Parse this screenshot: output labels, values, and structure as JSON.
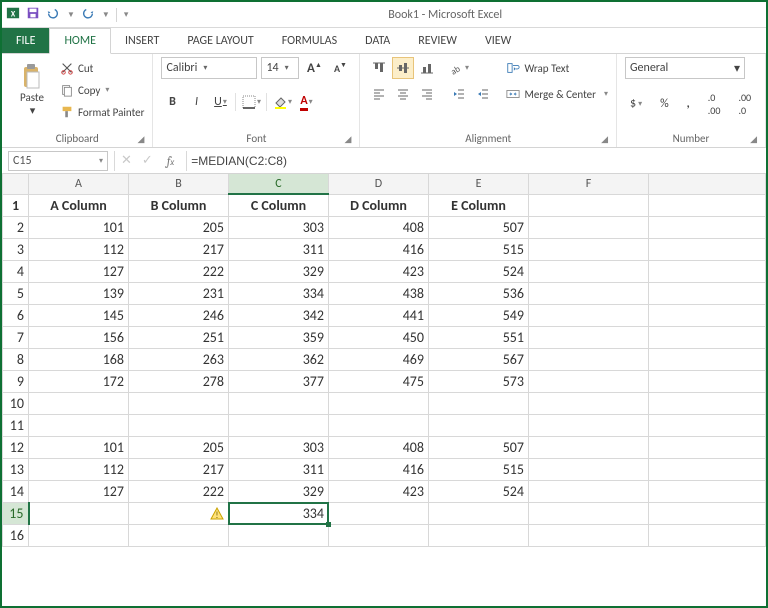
{
  "app": {
    "title": "Book1 - Microsoft Excel"
  },
  "tabs": {
    "file": "FILE",
    "home": "HOME",
    "insert": "INSERT",
    "page_layout": "PAGE LAYOUT",
    "formulas": "FORMULAS",
    "data": "DATA",
    "review": "REVIEW",
    "view": "VIEW"
  },
  "ribbon": {
    "clipboard": {
      "paste": "Paste",
      "cut": "Cut",
      "copy": "Copy",
      "format_painter": "Format Painter",
      "label": "Clipboard"
    },
    "font": {
      "name": "Calibri",
      "size": "14",
      "bold": "B",
      "italic": "I",
      "underline": "U",
      "label": "Font"
    },
    "alignment": {
      "wrap_text": "Wrap Text",
      "merge_center": "Merge & Center",
      "label": "Alignment"
    },
    "number": {
      "format": "General",
      "label": "Number"
    }
  },
  "formula_bar": {
    "cell_ref": "C15",
    "formula": "=MEDIAN(C2:C8)"
  },
  "chart_data": {
    "type": "table",
    "columns": [
      "A Column",
      "B Column",
      "C Column",
      "D Column",
      "E Column"
    ],
    "rows_2_9": [
      [
        101,
        205,
        303,
        408,
        507
      ],
      [
        112,
        217,
        311,
        416,
        515
      ],
      [
        127,
        222,
        329,
        423,
        524
      ],
      [
        139,
        231,
        334,
        438,
        536
      ],
      [
        145,
        246,
        342,
        441,
        549
      ],
      [
        156,
        251,
        359,
        450,
        551
      ],
      [
        168,
        263,
        362,
        469,
        567
      ],
      [
        172,
        278,
        377,
        475,
        573
      ]
    ],
    "rows_12_14": [
      [
        101,
        205,
        303,
        408,
        507
      ],
      [
        112,
        217,
        311,
        416,
        515
      ],
      [
        127,
        222,
        329,
        423,
        524
      ]
    ],
    "c15": 334
  },
  "grid": {
    "col_headers": [
      "A",
      "B",
      "C",
      "D",
      "E",
      "F"
    ],
    "headers_row": [
      "A Column",
      "B Column",
      "C Column",
      "D Column",
      "E Column",
      ""
    ],
    "rows": [
      {
        "n": "2",
        "c": [
          "101",
          "205",
          "303",
          "408",
          "507",
          ""
        ]
      },
      {
        "n": "3",
        "c": [
          "112",
          "217",
          "311",
          "416",
          "515",
          ""
        ]
      },
      {
        "n": "4",
        "c": [
          "127",
          "222",
          "329",
          "423",
          "524",
          ""
        ]
      },
      {
        "n": "5",
        "c": [
          "139",
          "231",
          "334",
          "438",
          "536",
          ""
        ]
      },
      {
        "n": "6",
        "c": [
          "145",
          "246",
          "342",
          "441",
          "549",
          ""
        ]
      },
      {
        "n": "7",
        "c": [
          "156",
          "251",
          "359",
          "450",
          "551",
          ""
        ]
      },
      {
        "n": "8",
        "c": [
          "168",
          "263",
          "362",
          "469",
          "567",
          ""
        ]
      },
      {
        "n": "9",
        "c": [
          "172",
          "278",
          "377",
          "475",
          "573",
          ""
        ]
      },
      {
        "n": "10",
        "c": [
          "",
          "",
          "",
          "",
          "",
          ""
        ]
      },
      {
        "n": "11",
        "c": [
          "",
          "",
          "",
          "",
          "",
          ""
        ]
      },
      {
        "n": "12",
        "c": [
          "101",
          "205",
          "303",
          "408",
          "507",
          ""
        ]
      },
      {
        "n": "13",
        "c": [
          "112",
          "217",
          "311",
          "416",
          "515",
          ""
        ]
      },
      {
        "n": "14",
        "c": [
          "127",
          "222",
          "329",
          "423",
          "524",
          ""
        ]
      },
      {
        "n": "15",
        "c": [
          "",
          "",
          "334",
          "",
          "",
          ""
        ]
      },
      {
        "n": "16",
        "c": [
          "",
          "",
          "",
          "",
          "",
          ""
        ]
      }
    ]
  }
}
